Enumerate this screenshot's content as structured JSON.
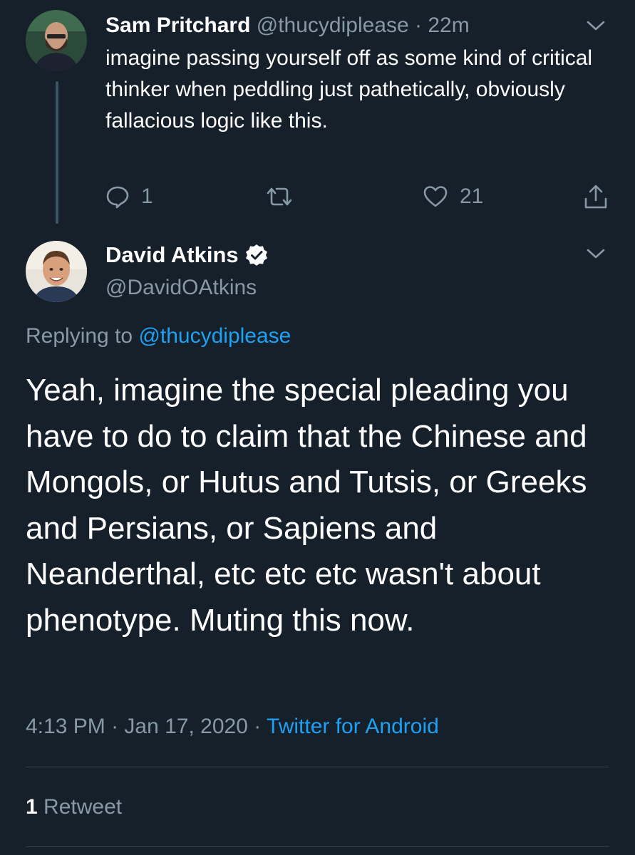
{
  "reply_tweet": {
    "author_name": "Sam Pritchard",
    "handle": "@thucydiplease",
    "separator": "·",
    "time": "22m",
    "text": "imagine passing yourself off as some kind of critical thinker when peddling just pathetically, obviously fallacious logic like this.",
    "reply_count": "1",
    "retweet_count": "",
    "like_count": "21"
  },
  "main_tweet": {
    "author_name": "David Atkins",
    "handle": "@DavidOAtkins",
    "verified": true,
    "replying_prefix": "Replying to",
    "replying_handle": "@thucydiplease",
    "text": "Yeah, imagine the special pleading you have to do to claim that the Chinese and Mongols, or Hutus and Tutsis, or Greeks and Persians, or Sapiens and Neanderthal, etc etc etc wasn't about phenotype. Muting this now.",
    "time": "4:13 PM",
    "date": "Jan 17, 2020",
    "separator": "·",
    "source": "Twitter for Android",
    "retweet_count": "1",
    "retweet_label": "Retweet"
  },
  "icons": {
    "reply": "reply-icon",
    "retweet": "retweet-icon",
    "like": "heart-icon",
    "share": "share-icon",
    "more": "chevron-down-icon",
    "verified": "verified-badge-icon"
  },
  "colors": {
    "background": "#15202b",
    "text": "#ffffff",
    "muted": "#8899a6",
    "link": "#1da1f2",
    "divider": "#38444d"
  }
}
